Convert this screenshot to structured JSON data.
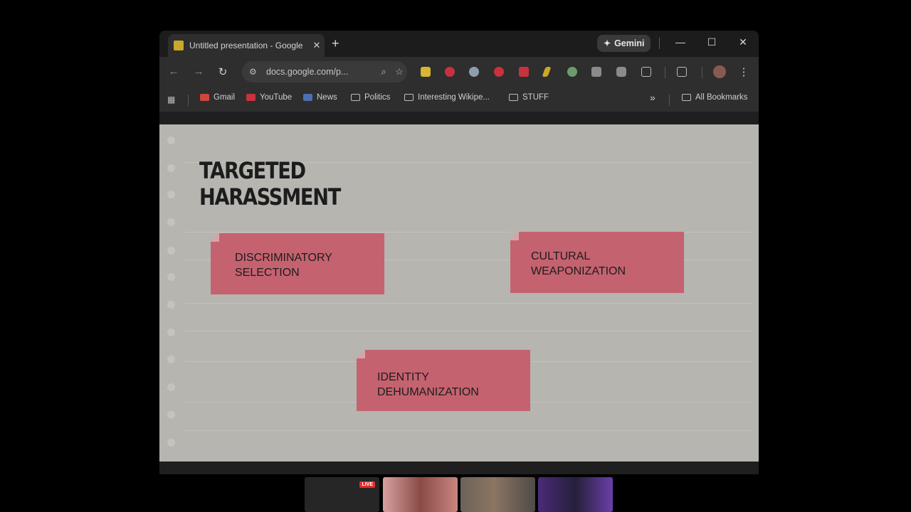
{
  "browser": {
    "tab_title": "Untitled presentation - Google",
    "new_tab_glyph": "+",
    "gemini_label": "Gemini",
    "url": "docs.google.com/p...",
    "window_controls": {
      "minimize": "—",
      "maximize": "☐",
      "close": "✕"
    }
  },
  "toolbar": {
    "back_glyph": "←",
    "forward_glyph": "→",
    "reload_glyph": "↻",
    "zoom_glyph": "⌕",
    "star_glyph": "☆",
    "menu_glyph": "⋮"
  },
  "bookmarks": {
    "items": [
      "Gmail",
      "YouTube",
      "News",
      "Politics",
      "Interesting Wikipe...",
      "STUFF"
    ],
    "overflow_glyph": "»",
    "all_bookmarks": "All Bookmarks"
  },
  "slide": {
    "title_line1": "TARGETED",
    "title_line2": "HARASSMENT",
    "notes": [
      {
        "line1": "DISCRIMINATORY",
        "line2": "SELECTION"
      },
      {
        "line1": "CULTURAL",
        "line2": "WEAPONIZATION"
      },
      {
        "line1": "IDENTITY",
        "line2": "DEHUMANIZATION"
      }
    ]
  },
  "stream": {
    "live_badge": "LIVE"
  },
  "colors": {
    "note_fill": "#c5626f",
    "slide_bg": "#b6b5b0",
    "chrome_bg": "#2e2e2e"
  }
}
